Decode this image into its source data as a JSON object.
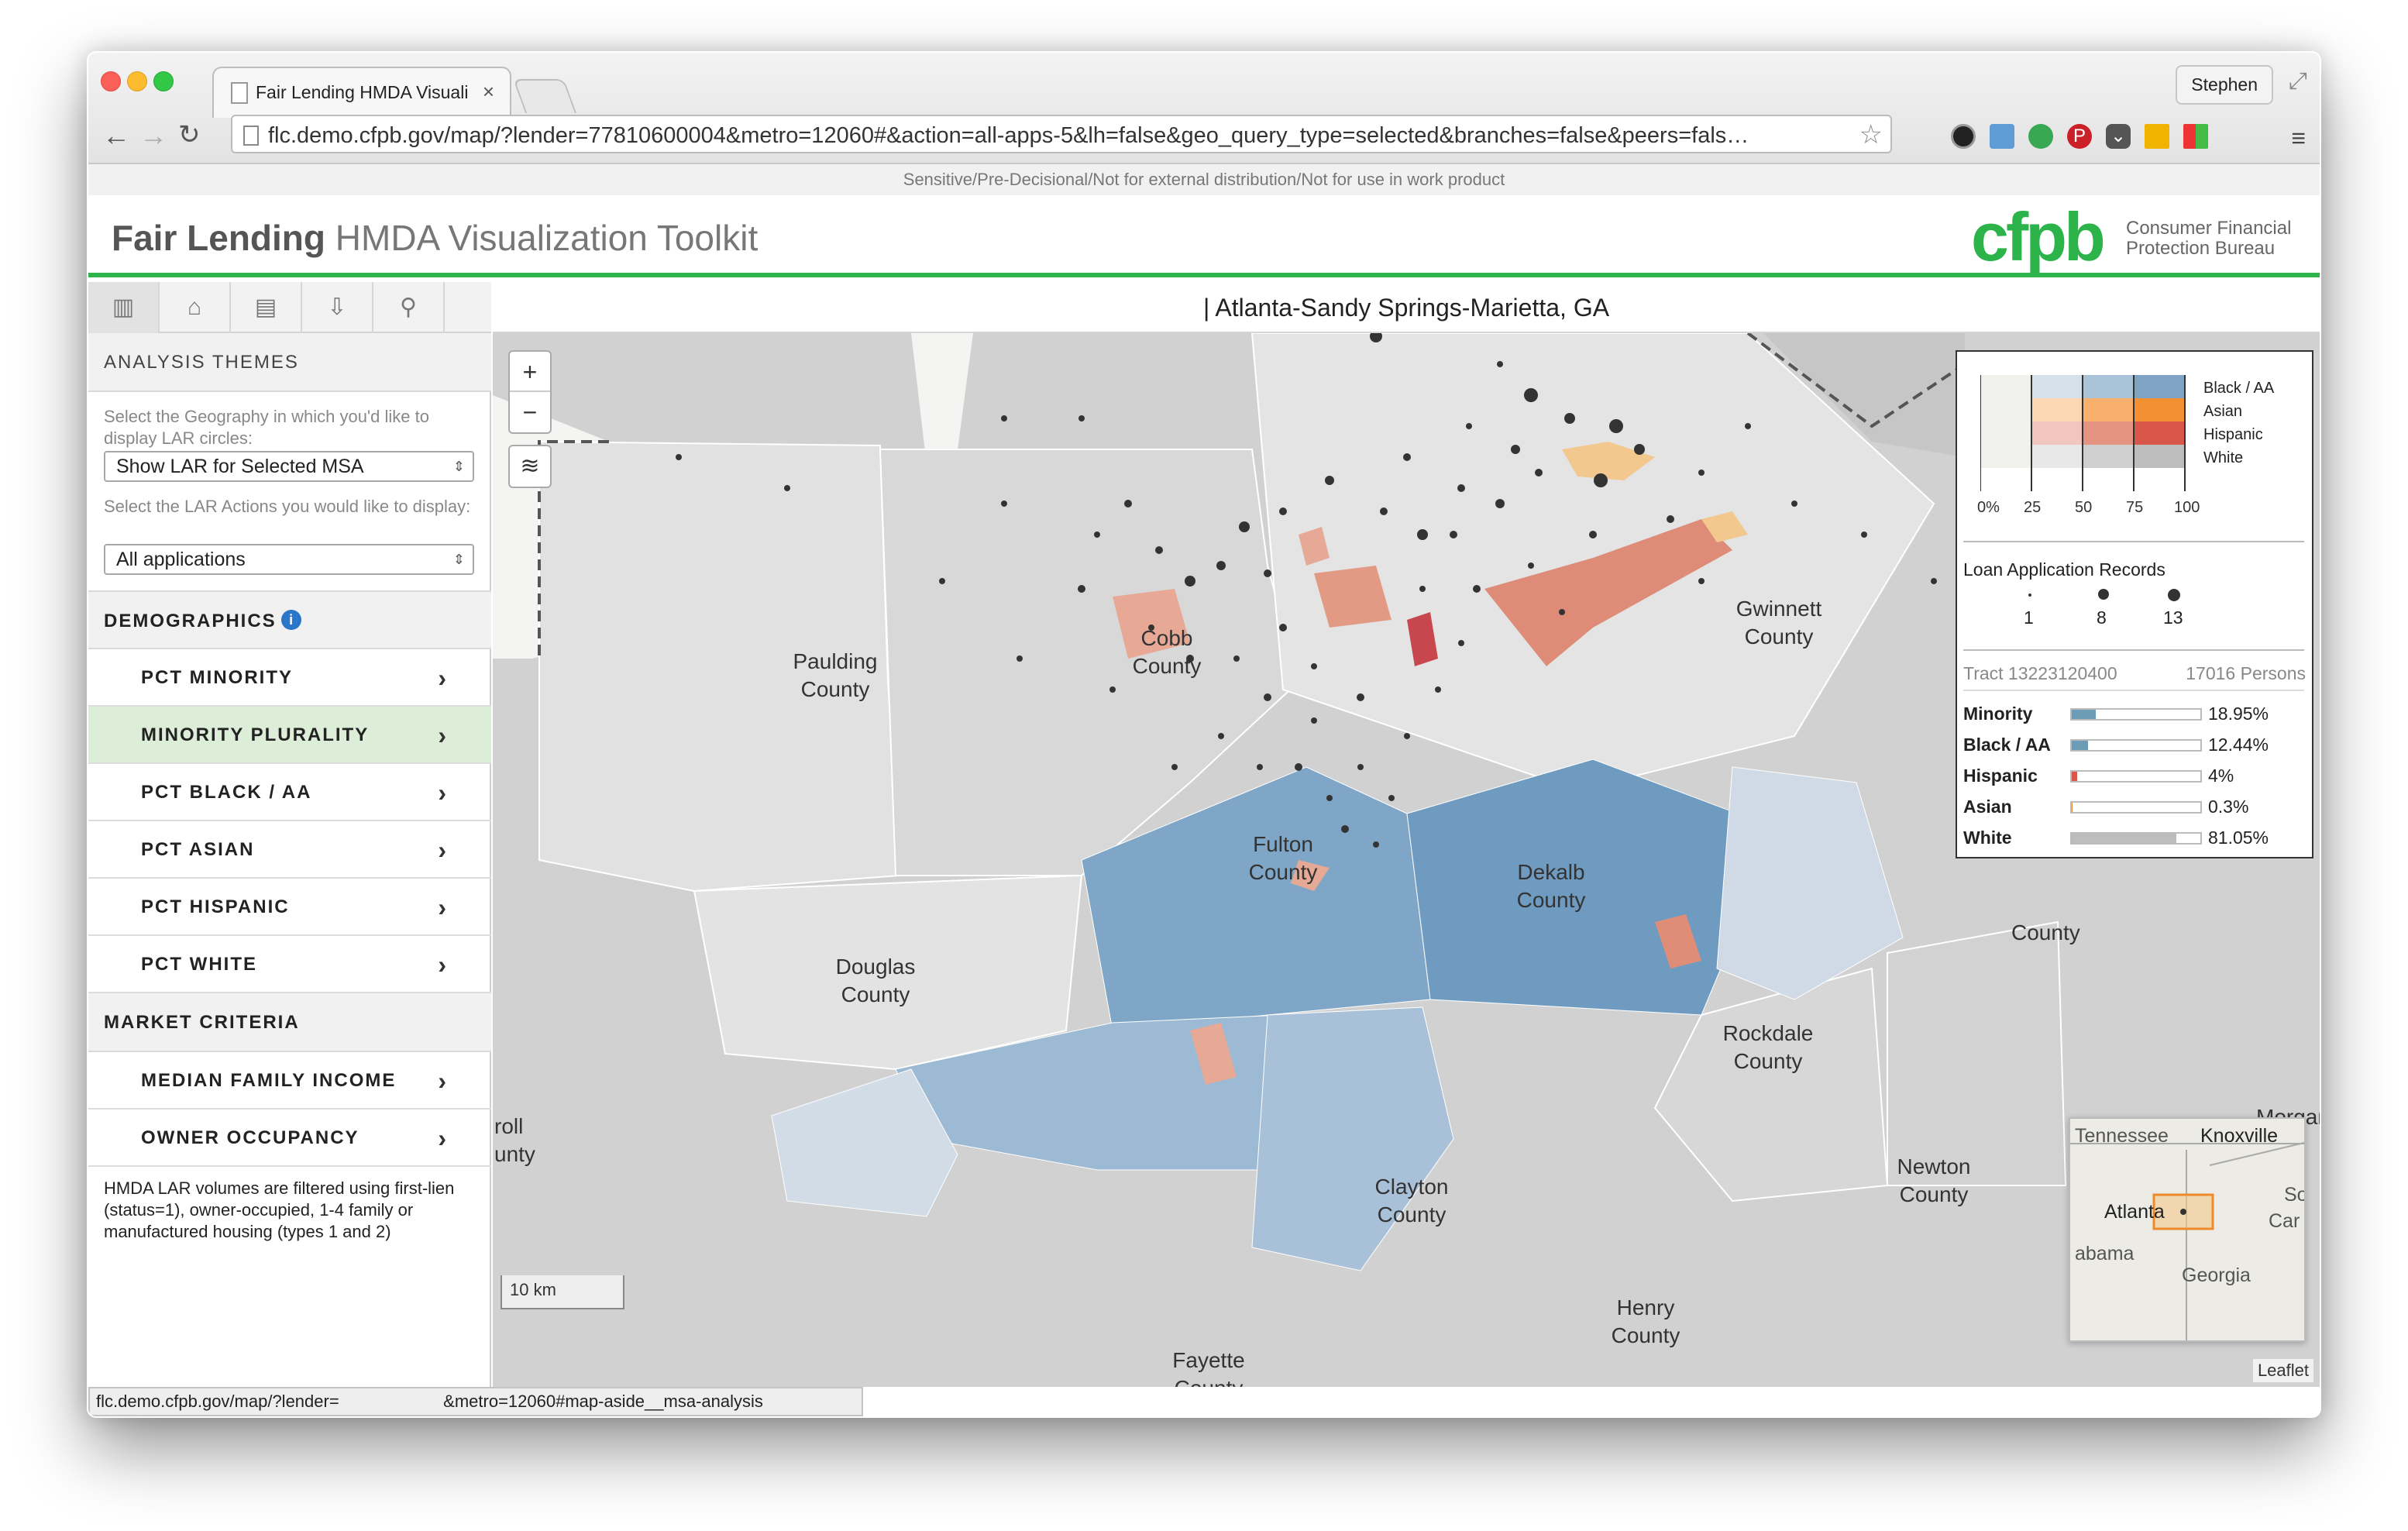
{
  "browser": {
    "tab_title": "Fair Lending HMDA Visuali",
    "tab_close": "×",
    "url": "flc.demo.cfpb.gov/map/?lender=77810600004&metro=12060#&action=all-apps-5&lh=false&geo_query_type=selected&branches=false&peers=fals…",
    "user": "Stephen",
    "status_url": "flc.demo.cfpb.gov/map/?lender=                      &metro=12060#map-aside__msa-analysis"
  },
  "notice": "Sensitive/Pre-Decisional/Not for external distribution/Not for use in work product",
  "header": {
    "title_bold": "Fair Lending",
    "title_light": "HMDA Visualization Toolkit",
    "logo": "cfpb",
    "logo_line1": "Consumer Financial",
    "logo_line2": "Protection Bureau"
  },
  "sidebar": {
    "analysis_themes": "ANALYSIS THEMES",
    "geo_help": "Select the Geography in which you'd like to display LAR circles:",
    "geo_select": "Show LAR for Selected MSA",
    "actions_help": "Select the LAR Actions you would like to display:",
    "actions_select": "All applications",
    "demographics": "DEMOGRAPHICS",
    "demographic_items": [
      "PCT MINORITY",
      "MINORITY PLURALITY",
      "PCT BLACK / AA",
      "PCT ASIAN",
      "PCT HISPANIC",
      "PCT WHITE"
    ],
    "market_criteria": "MARKET CRITERIA",
    "market_items": [
      "MEDIAN FAMILY INCOME",
      "OWNER OCCUPANCY"
    ],
    "footnote": "HMDA LAR volumes are filtered using first-lien (status=1), owner-occupied, 1-4 family or manufactured housing (types 1 and 2)"
  },
  "map": {
    "title": "| Atlanta-Sandy Springs-Marietta, GA",
    "zoom_in": "+",
    "zoom_out": "−",
    "counties": [
      "Paulding County",
      "Cobb County",
      "Gwinnett County",
      "Fulton County",
      "Dekalb County",
      "Douglas County",
      "Rockdale County",
      "Clayton County",
      "Newton County",
      "Henry County",
      "Fayette County"
    ],
    "edge_labels": [
      "roll",
      "unty",
      "Morgan",
      "County"
    ],
    "scale": "10 km",
    "attribution": "Leaflet",
    "inset_labels": [
      "Tennessee",
      "Knoxville",
      "Atlanta",
      "So",
      "Car",
      "abama",
      "Georgia"
    ]
  },
  "legend": {
    "series": [
      "Black / AA",
      "Asian",
      "Hispanic",
      "White"
    ],
    "ticks": [
      "0%",
      "25",
      "50",
      "75",
      "100"
    ],
    "lar_title": "Loan Application Records",
    "lar_sizes": [
      "1",
      "8",
      "13"
    ],
    "tract": "Tract 13223120400",
    "persons": "17016 Persons",
    "rows": [
      {
        "label": "Minority",
        "value": "18.95%",
        "pct": 18.95
      },
      {
        "label": "Black / AA",
        "value": "12.44%",
        "pct": 12.44
      },
      {
        "label": "Hispanic",
        "value": "4%",
        "pct": 4
      },
      {
        "label": "Asian",
        "value": "0.3%",
        "pct": 0.3
      },
      {
        "label": "White",
        "value": "81.05%",
        "pct": 81.05
      }
    ]
  }
}
